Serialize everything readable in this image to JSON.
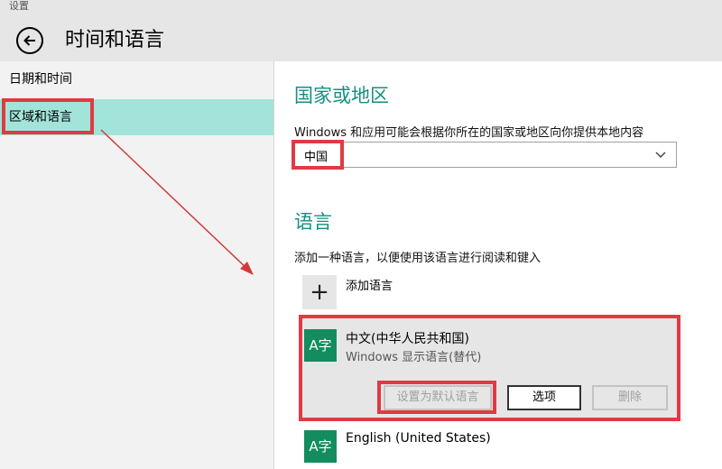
{
  "window": {
    "app_title": "设置",
    "page_title": "时间和语言"
  },
  "sidebar": {
    "items": [
      {
        "label": "日期和时间",
        "selected": false
      },
      {
        "label": "区域和语言",
        "selected": true
      }
    ]
  },
  "region": {
    "header": "国家或地区",
    "description": "Windows 和应用可能会根据你所在的国家或地区向你提供本地内容",
    "selected_value": "中国"
  },
  "language": {
    "header": "语言",
    "description": "添加一种语言，以便使用该语言进行阅读和键入",
    "add_label": "添加语言",
    "add_symbol": "+",
    "items": [
      {
        "icon_text": "A字",
        "name": "中文(中华人民共和国)",
        "subtitle": "Windows 显示语言(替代)",
        "buttons": {
          "set_default": "设置为默认语言",
          "options": "选项",
          "remove": "删除"
        }
      },
      {
        "icon_text": "A字",
        "name": "English (United States)"
      }
    ]
  },
  "colors": {
    "accent": "#168e82",
    "selected_bg": "#a2e4d9",
    "highlight_red": "#e03a43",
    "lang_icon_bg": "#138d5f"
  }
}
